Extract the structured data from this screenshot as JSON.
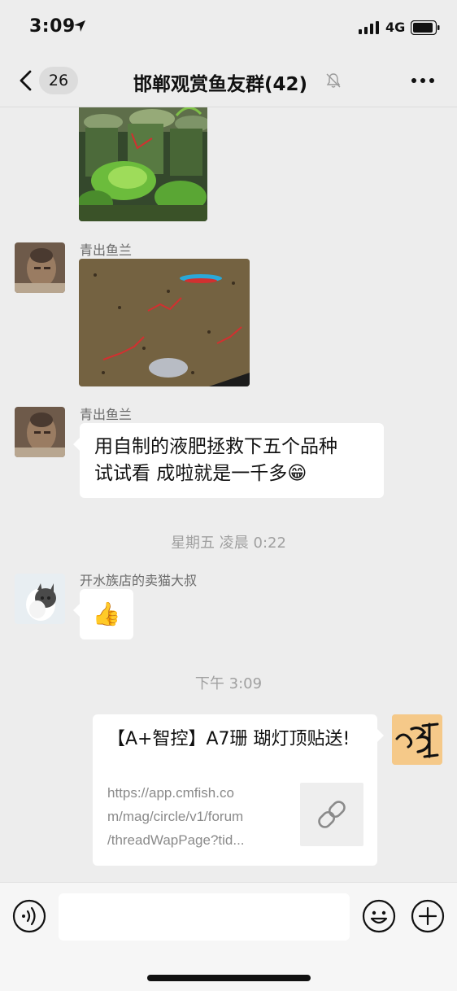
{
  "status_bar": {
    "time": "3:09",
    "network": "4G"
  },
  "nav": {
    "unread_count": "26",
    "title": "邯郸观赏鱼友群(42)"
  },
  "messages": [
    {
      "type": "image",
      "sender": "",
      "description": "plant-jars-photo"
    },
    {
      "type": "image",
      "sender": "青出鱼兰",
      "description": "aquarium-gravel-photo"
    },
    {
      "type": "text",
      "sender": "青出鱼兰",
      "line1": "用自制的液肥拯救下五个品种",
      "line2": "试试看 成啦就是一千多",
      "emoji": "😁"
    },
    {
      "type": "timestamp",
      "text": "星期五 凌晨 0:22"
    },
    {
      "type": "emoji",
      "sender": "开水族店的卖猫大叔",
      "emoji": "👍"
    },
    {
      "type": "timestamp",
      "text": "下午 3:09"
    },
    {
      "type": "link",
      "sender": "self",
      "title": "【A+智控】A7珊 瑚灯顶贴送!",
      "url_line1": "https://app.cmfish.co",
      "url_line2": "m/mag/circle/v1/forum",
      "url_line3": "/threadWapPage?tid..."
    }
  ],
  "input": {
    "placeholder": ""
  },
  "icons": {
    "back": "chevron-left-icon",
    "mute": "bell-slash-icon",
    "more": "ellipsis-icon",
    "voice": "voice-icon",
    "emoji": "smiley-icon",
    "plus": "plus-icon",
    "link": "link-icon"
  },
  "colors": {
    "background": "#ededed",
    "bubble": "#ffffff",
    "sender_text": "#6b6b6b",
    "timestamp": "#a0a0a0"
  }
}
